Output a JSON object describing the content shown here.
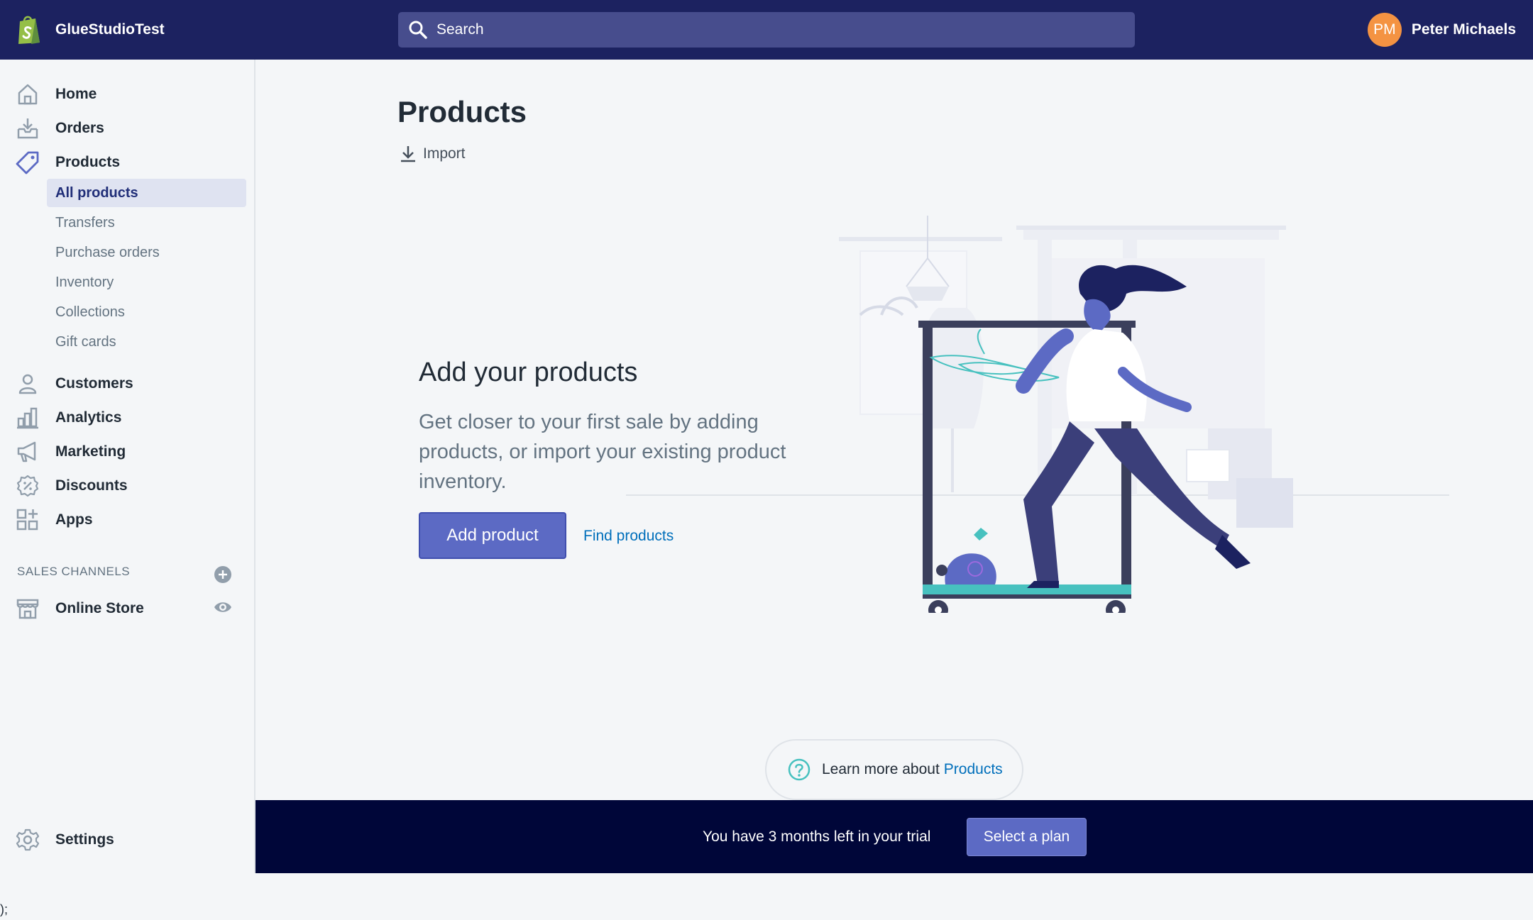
{
  "topbar": {
    "store_name": "GlueStudioTest",
    "search_placeholder": "Search",
    "user_initials": "PM",
    "user_name": "Peter Michaels"
  },
  "sidebar": {
    "items": [
      {
        "label": "Home",
        "icon": "home-icon"
      },
      {
        "label": "Orders",
        "icon": "orders-icon"
      },
      {
        "label": "Products",
        "icon": "tag-icon"
      }
    ],
    "product_subitems": [
      "All products",
      "Transfers",
      "Purchase orders",
      "Inventory",
      "Collections",
      "Gift cards"
    ],
    "more_items": [
      {
        "label": "Customers",
        "icon": "customer-icon"
      },
      {
        "label": "Analytics",
        "icon": "analytics-icon"
      },
      {
        "label": "Marketing",
        "icon": "megaphone-icon"
      },
      {
        "label": "Discounts",
        "icon": "discount-icon"
      },
      {
        "label": "Apps",
        "icon": "apps-icon"
      }
    ],
    "sales_channels_title": "SALES CHANNELS",
    "online_store": "Online Store",
    "settings": "Settings"
  },
  "main": {
    "title": "Products",
    "import_label": "Import",
    "empty_heading": "Add your products",
    "empty_text": "Get closer to your first sale by adding products, or import your existing product inventory.",
    "add_product": "Add product",
    "find_products": "Find products",
    "learn_prefix": "Learn more about",
    "learn_link": "Products"
  },
  "trial": {
    "text": "You have 3 months left in your trial",
    "button": "Select a plan"
  },
  "stray_text": ");",
  "colors": {
    "topbar": "#1c2260",
    "search": "#474d8d",
    "primary": "#5c6ac4",
    "avatar": "#f49342",
    "link": "#006fbb",
    "trial_bg": "#000639"
  }
}
